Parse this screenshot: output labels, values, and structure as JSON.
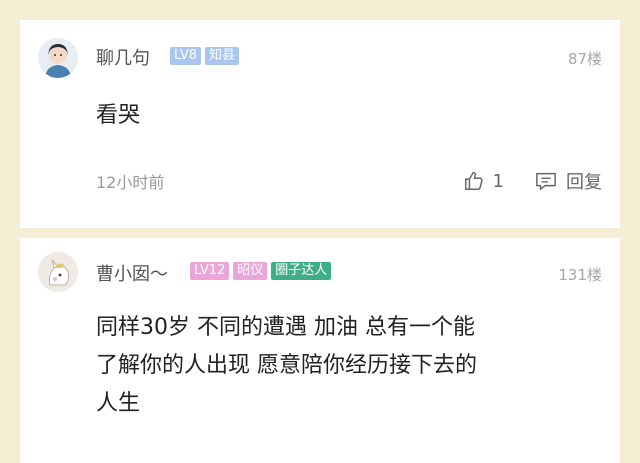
{
  "comments": [
    {
      "username": "聊几句",
      "badges": [
        "LV8",
        "知县"
      ],
      "floor": "87楼",
      "text": "看哭",
      "time": "12小时前",
      "like_count": "1",
      "reply_label": "回复",
      "avatar_icon": "girl-avatar"
    },
    {
      "username": "曹小囡〜",
      "badges": [
        "LV12",
        "昭仪",
        "圈子达人"
      ],
      "floor": "131楼",
      "text_line1": "同样30岁 不同的遭遇 加油 总有一个能",
      "text_line2": "了解你的人出现 愿意陪你经历接下去的",
      "text_line3": "人生",
      "avatar_icon": "unicorn-avatar"
    }
  ],
  "colors": {
    "background": "#f4efd4",
    "badge_blue": "#a9c6ef",
    "badge_pink": "#eaa6d9",
    "badge_green": "#3fae86"
  }
}
